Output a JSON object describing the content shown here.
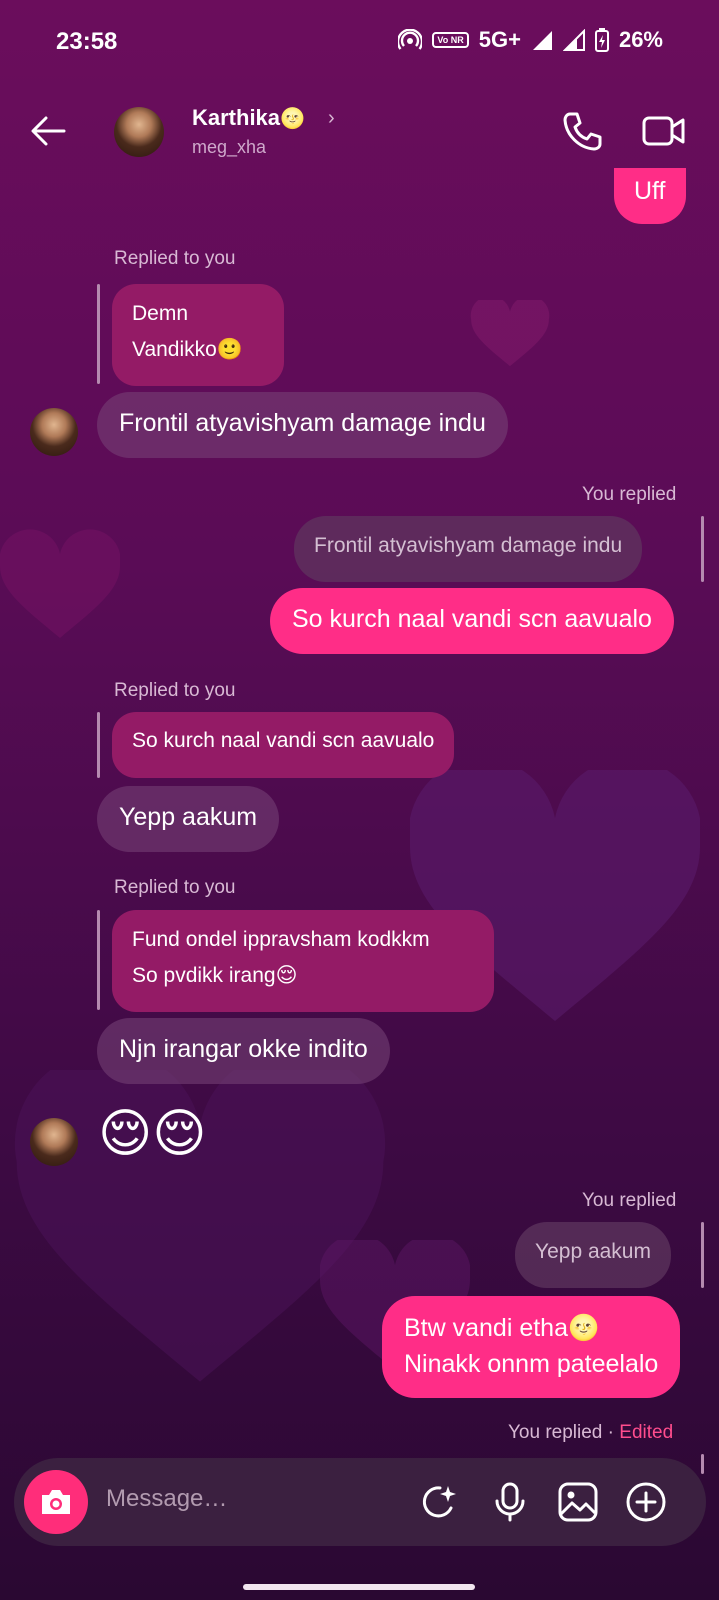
{
  "status": {
    "time": "23:58",
    "network": "5G+",
    "volte": "Vo NR",
    "battery": "26%"
  },
  "header": {
    "name": "Karthika",
    "name_emoji": "🌝",
    "chevron": "›",
    "username": "meg_xha"
  },
  "messages": {
    "uff": "Uff",
    "label1": "Replied to you",
    "quote1_line1": "Demn",
    "quote1_line2": "Vandikko🙂",
    "msg1": "Frontil atyavishyam damage indu",
    "label2": "You replied",
    "quote2": "Frontil atyavishyam damage indu",
    "msg2": "So kurch naal vandi scn aavualo",
    "label3": "Replied to you",
    "quote3": "So kurch naal vandi scn aavualo",
    "msg3": "Yepp aakum",
    "label4": "Replied to you",
    "quote4_line1": "Fund ondel ippravsham kodkkm",
    "quote4_line2": "So pvdikk irang😌",
    "msg4": "Njn irangar okke indito",
    "emojis": "😌😌",
    "label5": "You replied",
    "quote5": "Yepp aakum",
    "msg5_line1": "Btw vandi etha🌝",
    "msg5_line2": "Ninakk onnm pateelalo",
    "label6": "You replied ·",
    "label6_edited": "Edited"
  },
  "composer": {
    "placeholder": "Message…"
  },
  "colors": {
    "accent": "#ff2d87",
    "edited": "#ff4d8d"
  }
}
